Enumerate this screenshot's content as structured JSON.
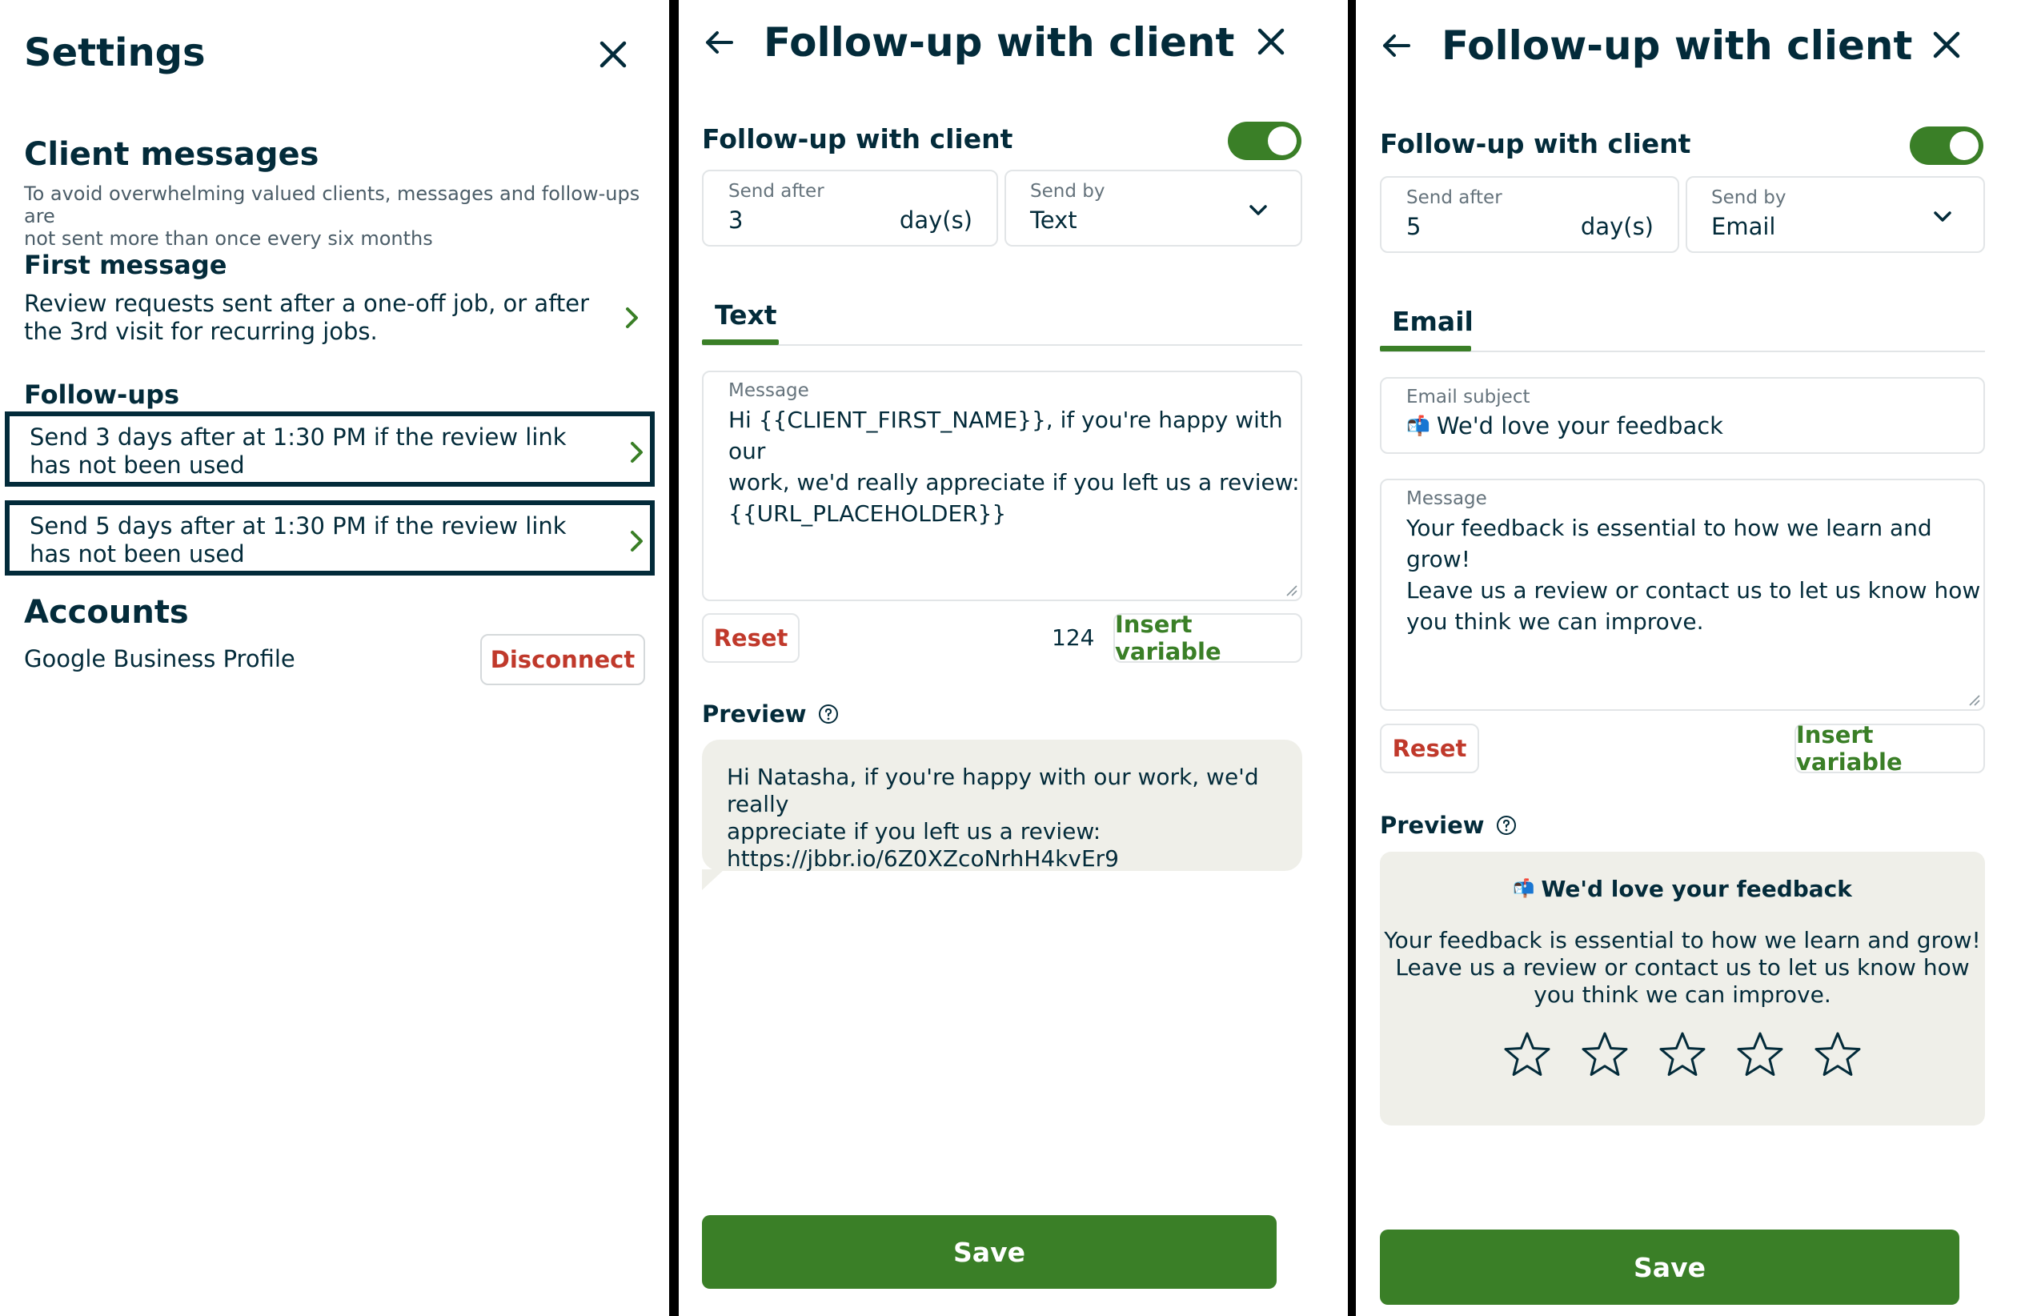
{
  "settings": {
    "title": "Settings",
    "client_messages": {
      "heading": "Client messages",
      "subtext_1": "To avoid overwhelming valued clients, messages and follow-ups are",
      "subtext_2": "not sent more than once every six months"
    },
    "first_message": {
      "heading": "First message",
      "line_1": "Review requests sent after a one-off job, or after",
      "line_2": "the 3rd visit for recurring jobs."
    },
    "followups": {
      "heading": "Follow-ups",
      "items": [
        {
          "line_1": "Send 3 days after at 1:30 PM if the review link",
          "line_2": "has not been used"
        },
        {
          "line_1": "Send 5 days after at 1:30 PM if the review link",
          "line_2": "has not been used"
        }
      ]
    },
    "accounts": {
      "heading": "Accounts",
      "profile": "Google Business Profile",
      "disconnect": "Disconnect"
    }
  },
  "followup_text": {
    "title": "Follow-up with client",
    "section_title": "Follow-up with client",
    "enabled": true,
    "send_after_label": "Send after",
    "send_after_value": "3",
    "send_after_unit": "day(s)",
    "send_by_label": "Send by",
    "send_by_value": "Text",
    "tab": "Text",
    "message_label": "Message",
    "message_lines": [
      "Hi {{CLIENT_FIRST_NAME}}, if you're happy with our",
      "work, we'd really appreciate if you left us a review:",
      "{{URL_PLACEHOLDER}}"
    ],
    "reset": "Reset",
    "char_count": "124",
    "insert_variable": "Insert variable",
    "preview_label": "Preview",
    "preview_lines": [
      "Hi Natasha, if you're happy with our work, we'd really",
      "appreciate if you left us a review:",
      "https://jbbr.io/6Z0XZcoNrhH4kvEr9"
    ],
    "save": "Save"
  },
  "followup_email": {
    "title": "Follow-up with client",
    "section_title": "Follow-up with client",
    "enabled": true,
    "send_after_label": "Send after",
    "send_after_value": "5",
    "send_after_unit": "day(s)",
    "send_by_label": "Send by",
    "send_by_value": "Email",
    "tab": "Email",
    "subject_label": "Email subject",
    "subject_icon": "📬",
    "subject_value": "We'd love your feedback",
    "message_label": "Message",
    "message_lines": [
      "Your feedback is essential to how we learn and grow!",
      "Leave us a review or contact us to let us know how",
      "you think we can improve."
    ],
    "reset": "Reset",
    "insert_variable": "Insert variable",
    "preview_label": "Preview",
    "preview_subject_icon": "📬",
    "preview_subject": "We'd love your feedback",
    "preview_lines": [
      "Your feedback is essential to how we learn and grow!",
      "Leave us a review or contact us to let us know how",
      "you think we can improve."
    ],
    "star_count": 5,
    "save": "Save"
  },
  "colors": {
    "brand_green": "#3a7f27",
    "destructive_red": "#c0392b",
    "text_dark": "#032b3a",
    "preview_bg": "#efefe9"
  }
}
